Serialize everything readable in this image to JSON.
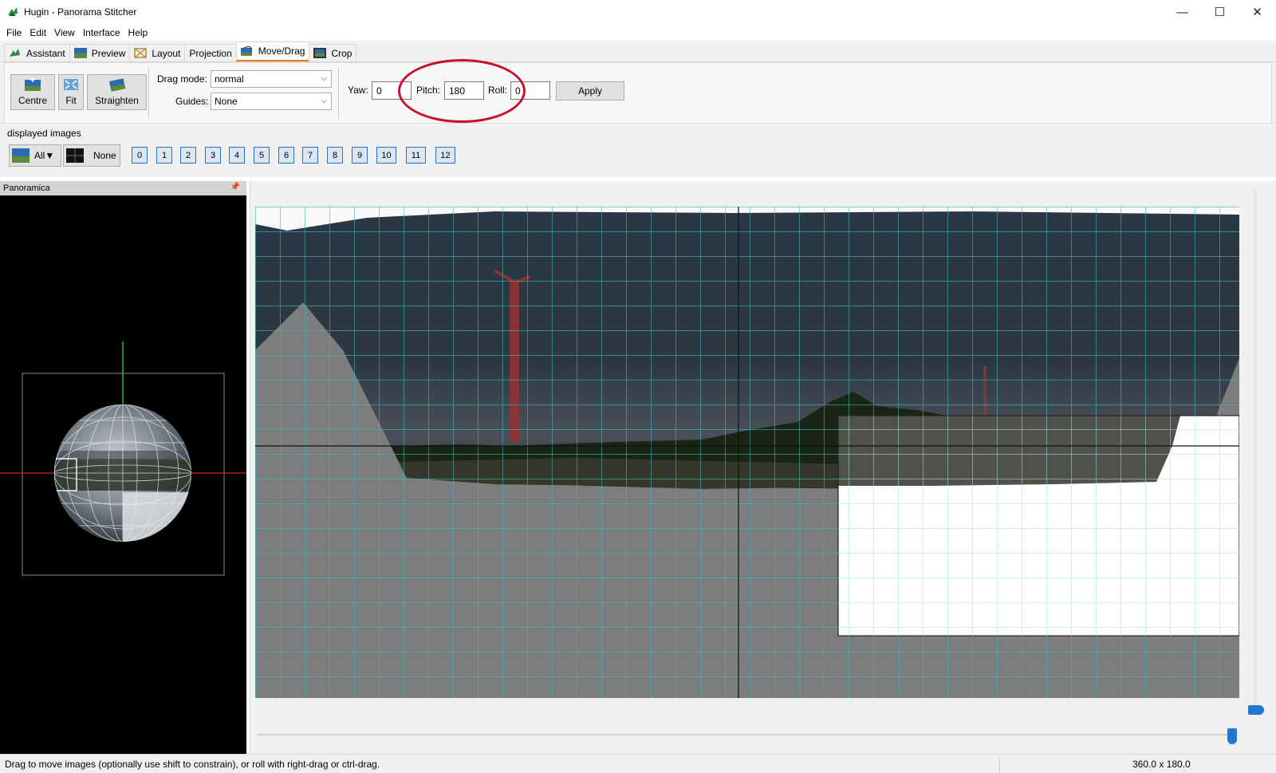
{
  "window": {
    "title": "Hugin - Panorama Stitcher",
    "minimize": "—",
    "maximize": "☐",
    "close": "✕"
  },
  "menu": [
    "File",
    "Edit",
    "View",
    "Interface",
    "Help"
  ],
  "tabs": [
    {
      "label": "Assistant",
      "icon": "assistant-icon"
    },
    {
      "label": "Preview",
      "icon": "preview-icon"
    },
    {
      "label": "Layout",
      "icon": "layout-icon"
    },
    {
      "label": "Projection",
      "icon": ""
    },
    {
      "label": "Move/Drag",
      "icon": "move-drag-icon",
      "active": true
    },
    {
      "label": "Crop",
      "icon": "crop-icon"
    }
  ],
  "toolbar": {
    "centre_label": "Centre",
    "fit_label": "Fit",
    "straighten_label": "Straighten",
    "drag_mode_label": "Drag mode:",
    "drag_mode_value": "normal",
    "guides_label": "Guides:",
    "guides_value": "None",
    "yaw_label": "Yaw:",
    "yaw_value": "0",
    "pitch_label": "Pitch:",
    "pitch_value": "180",
    "roll_label": "Roll:",
    "roll_value": "0",
    "apply_label": "Apply"
  },
  "displayed_images": {
    "label": "displayed images",
    "all_label": "All▼",
    "none_label": "None",
    "numbers": [
      "0",
      "1",
      "2",
      "3",
      "4",
      "5",
      "6",
      "7",
      "8",
      "9",
      "10",
      "11",
      "12"
    ]
  },
  "sidebar": {
    "title": "Panoramica"
  },
  "status": {
    "message": "Drag to move images (optionally use shift to constrain), or roll with right-drag or ctrl-drag.",
    "dimensions": "360.0 x 180.0"
  },
  "colors": {
    "accent": "#1e78d4",
    "active_tab_underline": "#e8791a",
    "annotation": "#c8102e",
    "grid": "#3fb6b6"
  }
}
